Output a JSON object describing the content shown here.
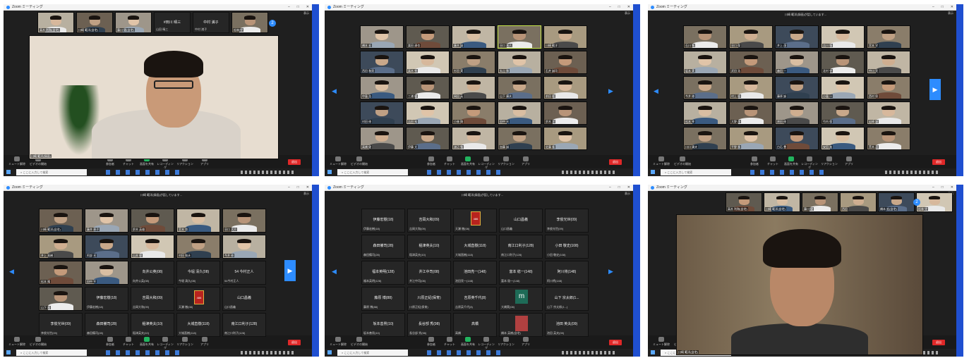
{
  "ui": {
    "title": "Zoom ミーティング",
    "view_label": "表示",
    "end_label": "退出",
    "search_placeholder": "ここに入力して検索",
    "recording_banner": "川崎 範洋(録画)が話しています...",
    "left_arrow": "◀",
    "right_arrow": "▶",
    "controls": [
      "ミュート解除",
      "ビデオの開始",
      "参加者",
      "チャット",
      "画面を共有",
      "レコーディング",
      "リアクション",
      "アプリ"
    ]
  },
  "colors": {
    "accent": "#2d8cff",
    "end": "#e02828",
    "desktop": "#1f4fd0",
    "meeting_bg": "#1f1f1f"
  },
  "icons": [
    "microphone-icon",
    "video-icon",
    "participants-icon",
    "chat-icon",
    "share-screen-icon",
    "record-icon",
    "reaction-icon",
    "apps-icon",
    "windows-start-icon",
    "search-icon"
  ],
  "panel1": {
    "speaker_label": "川崎 範洋(録画)",
    "strip": [
      {
        "name": "高木 利和(自宅)",
        "kind": "video"
      },
      {
        "name": "川崎 範洋(自宅)",
        "kind": "video"
      },
      {
        "name": "藤川 健(自宅)",
        "kind": "video"
      },
      {
        "name": "山田 晴三",
        "kind": "name",
        "big": "#田川 晴三"
      },
      {
        "name": "中村 満子",
        "kind": "name",
        "big": "中村 満子"
      },
      {
        "name": "松林 守",
        "kind": "video"
      }
    ]
  },
  "panel2": {
    "names": [
      "橋本 宏",
      "栗田 達也",
      "藤木 誠",
      "谷口 直人",
      "川崎 範洋",
      "西田 和男",
      "高木 秀",
      "杉田 実",
      "丸山 勝",
      "石井 誠司",
      "中島 浩",
      "三浦 健",
      "岡田 英",
      "山下 康夫",
      "前田 聡",
      "村田 修",
      "吉田 裕",
      "小林 剛",
      "田中 光",
      "鈴木 洋",
      "高橋 健",
      "伊藤 大",
      "渡辺 勉",
      "加藤 誠",
      "佐藤 隆"
    ]
  },
  "panel3": {
    "names": [
      "石川 勉",
      "谷口 保",
      "井上 茂",
      "吉川 慎",
      "宮本 学",
      "坂本 実",
      "武田 浩",
      "森田 一",
      "北村 守",
      "中川 亮",
      "今井 修",
      "村上 稔",
      "藤原 誠",
      "小島 一",
      "西村 保",
      "松本 幸",
      "大野 茂",
      "原田 修",
      "竹内 保",
      "岩崎 誠",
      "川口 康夫",
      "平野 勝",
      "白石 豊",
      "安田 進",
      "荒木 茂"
    ]
  },
  "panel4": {
    "video_names": [
      "川崎 範洋(自宅)",
      "藤井 恵子",
      "鈴木 英雄",
      "宮本 悠",
      "谷口 大介",
      "井上 直樹",
      "阿部 光",
      "山本 健",
      "村田 和夫",
      "今井 修",
      "松本 隆",
      "田中 亨",
      "山下 隆",
      "石田 啓"
    ],
    "name_tiles": [
      {
        "big": "向井公英(08)",
        "small": "向井公英(08)"
      },
      {
        "big": "今堀 清久(08)",
        "small": "今堀 清久(08)"
      },
      {
        "big": "54 今村正人",
        "small": "54今村正人"
      },
      {
        "big": "伊藤宏樹(18)",
        "small": "伊藤宏樹(18)"
      },
      {
        "big": "吉岡大和(09)",
        "small": "吉岡大和(09)"
      },
      {
        "big": "486",
        "small": "天瀬 徹(08)"
      },
      {
        "big": "山口昌義",
        "small": "山口昌義"
      },
      {
        "big": "李俊光世(09)",
        "small": "李俊光世(09)"
      },
      {
        "big": "森田備司(28)",
        "small": "森田備司(28)"
      },
      {
        "big": "稲津英夫(10)",
        "small": "稲津英夫(10)"
      },
      {
        "big": "大城直樹(118)",
        "small": "大城直樹(118)"
      },
      {
        "big": "南江口利子(128)",
        "small": "南江口利子(128)"
      }
    ]
  },
  "panel5": {
    "tiles": [
      {
        "big": "伊藤宏樹(18)",
        "small": "伊藤宏樹(18)"
      },
      {
        "big": "吉岡大和(09)",
        "small": "吉岡大和(09)"
      },
      {
        "big": "486",
        "small": "天瀬 徹(08)"
      },
      {
        "big": "山口昌義",
        "small": "山口昌義"
      },
      {
        "big": "李俊光世(09)",
        "small": "李俊光世(09)"
      },
      {
        "big": "森田備司(28)",
        "small": "森田備司(28)"
      },
      {
        "big": "稲津英夫(10)",
        "small": "稲津英夫(10)"
      },
      {
        "big": "大城直樹(118)",
        "small": "大城直樹(118)"
      },
      {
        "big": "南江口利子(128)",
        "small": "南江口利子(128)"
      },
      {
        "big": "小田 敬史(108)",
        "small": "小田 敬史(108)"
      },
      {
        "big": "福本英明(128)",
        "small": "福本英明(128)"
      },
      {
        "big": "井江中司(08)",
        "small": "井江中司(08)"
      },
      {
        "big": "池田亮一(148)",
        "small": "池田亮一(148)"
      },
      {
        "big": "富本 稔一(148)",
        "small": "富本 稔一(148)"
      },
      {
        "big": "阿川将(148)",
        "small": "阿川将(148)"
      },
      {
        "big": "藤原 博(88)",
        "small": "藤原 博(88)"
      },
      {
        "big": "川原正紀(保育)",
        "small": "川原正紀(保育)"
      },
      {
        "big": "吉原英千代(8)",
        "small": "吉原英千代(8)"
      },
      {
        "big": "m",
        "small": "大橋実(08)"
      },
      {
        "big": "山下 宗太郎(1...",
        "small": "山下 宗太郎(1...)"
      },
      {
        "big": "坂本善男(10)",
        "small": "坂本善男(10)"
      },
      {
        "big": "長谷部 秀(98)",
        "small": "長谷部 秀(98)"
      },
      {
        "big": "高橋",
        "small": "高橋"
      },
      {
        "big": "",
        "small": "橋本 英樹(自宅)"
      },
      {
        "big": "池田 英夫(09)",
        "small": "池田 英夫(09)"
      }
    ]
  },
  "panel6": {
    "speaker_label": "川崎 範洋(自宅)",
    "strip": [
      "高木 利和(自宅)",
      "川崎 範洋(自宅)",
      "藤川 健",
      "西田",
      "橋本 宏(自宅)",
      "松林 守"
    ]
  }
}
